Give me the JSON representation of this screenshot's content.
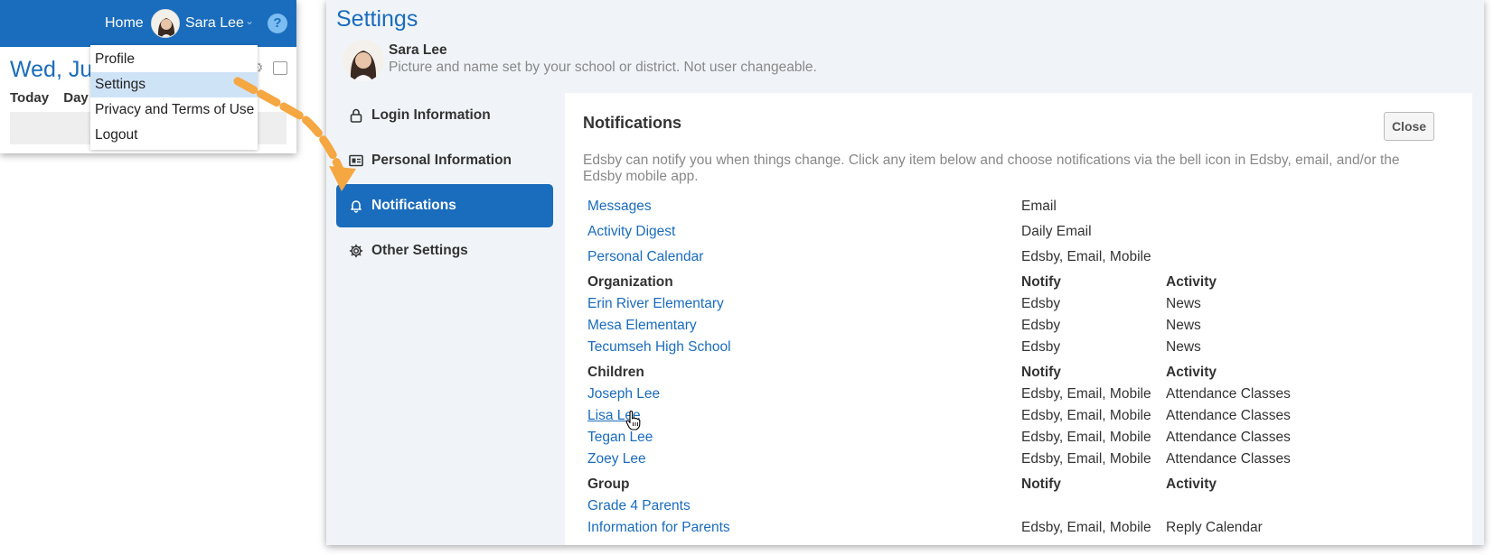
{
  "topbar": {
    "home_label": "Home",
    "user_name": "Sara Lee",
    "help_label": "?"
  },
  "calendar_preview": {
    "date_label": "Wed, Jun",
    "tabs": [
      "Today",
      "Day"
    ]
  },
  "user_menu": {
    "items": [
      "Profile",
      "Settings",
      "Privacy and Terms of Use",
      "Logout"
    ],
    "selected": "Settings"
  },
  "settings": {
    "title": "Settings",
    "profile_name": "Sara Lee",
    "profile_note": "Picture and name set by your school or district. Not user changeable.",
    "nav": [
      {
        "label": "Login Information",
        "icon": "lock-icon"
      },
      {
        "label": "Personal Information",
        "icon": "id-card-icon"
      },
      {
        "label": "Notifications",
        "icon": "bell-icon"
      },
      {
        "label": "Other Settings",
        "icon": "gear-icon"
      }
    ],
    "active_nav": "Notifications",
    "accent_color": "#1a6cbc"
  },
  "notifications": {
    "title": "Notifications",
    "close_label": "Close",
    "description": "Edsby can notify you when things change. Click any item below and choose notifications via the bell icon in Edsby, email, and/or the Edsby mobile app.",
    "general": [
      {
        "name": "Messages",
        "notify": "Email"
      },
      {
        "name": "Activity Digest",
        "notify": "Daily Email"
      },
      {
        "name": "Personal Calendar",
        "notify": "Edsby, Email, Mobile"
      }
    ],
    "organization": {
      "header": "Organization",
      "notify_header": "Notify",
      "activity_header": "Activity",
      "rows": [
        {
          "name": "Erin River Elementary",
          "notify": "Edsby",
          "activity": "News"
        },
        {
          "name": "Mesa Elementary",
          "notify": "Edsby",
          "activity": "News"
        },
        {
          "name": "Tecumseh High School",
          "notify": "Edsby",
          "activity": "News"
        }
      ]
    },
    "children": {
      "header": "Children",
      "notify_header": "Notify",
      "activity_header": "Activity",
      "rows": [
        {
          "name": "Joseph Lee",
          "notify": "Edsby, Email, Mobile",
          "activity": "Attendance Classes"
        },
        {
          "name": "Lisa Lee",
          "notify": "Edsby, Email, Mobile",
          "activity": "Attendance Classes"
        },
        {
          "name": "Tegan Lee",
          "notify": "Edsby, Email, Mobile",
          "activity": "Attendance Classes"
        },
        {
          "name": "Zoey Lee",
          "notify": "Edsby, Email, Mobile",
          "activity": "Attendance Classes"
        }
      ]
    },
    "group": {
      "header": "Group",
      "notify_header": "Notify",
      "activity_header": "Activity",
      "rows": [
        {
          "name": "Grade 4 Parents",
          "notify": "",
          "activity": ""
        },
        {
          "name": "Information for Parents",
          "notify": "Edsby, Email, Mobile",
          "activity": "Reply Calendar"
        }
      ]
    }
  }
}
